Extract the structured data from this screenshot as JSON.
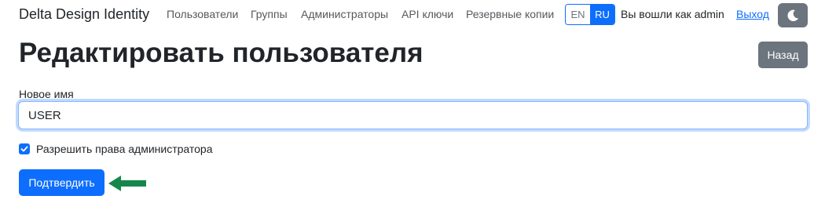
{
  "navbar": {
    "brand": "Delta Design Identity",
    "links": [
      "Пользователи",
      "Группы",
      "Администраторы",
      "API ключи",
      "Резервные копии"
    ],
    "languages": {
      "en": "EN",
      "ru": "RU",
      "active": "RU"
    },
    "logged_in_text": "Вы вошли как admin",
    "logout_label": "Выход",
    "theme_icon": "moon-icon"
  },
  "page": {
    "title": "Редактировать пользователя",
    "back_label": "Назад"
  },
  "form": {
    "name_label": "Новое имя",
    "name_value": "USER",
    "admin_checkbox_label": "Разрешить права администратора",
    "admin_checked": true,
    "submit_label": "Подтвердить"
  },
  "annotation": {
    "arrow_icon": "arrow-left-icon",
    "arrow_color": "#16874b"
  },
  "colors": {
    "primary": "#0d6efd",
    "secondary": "#6c757d"
  }
}
